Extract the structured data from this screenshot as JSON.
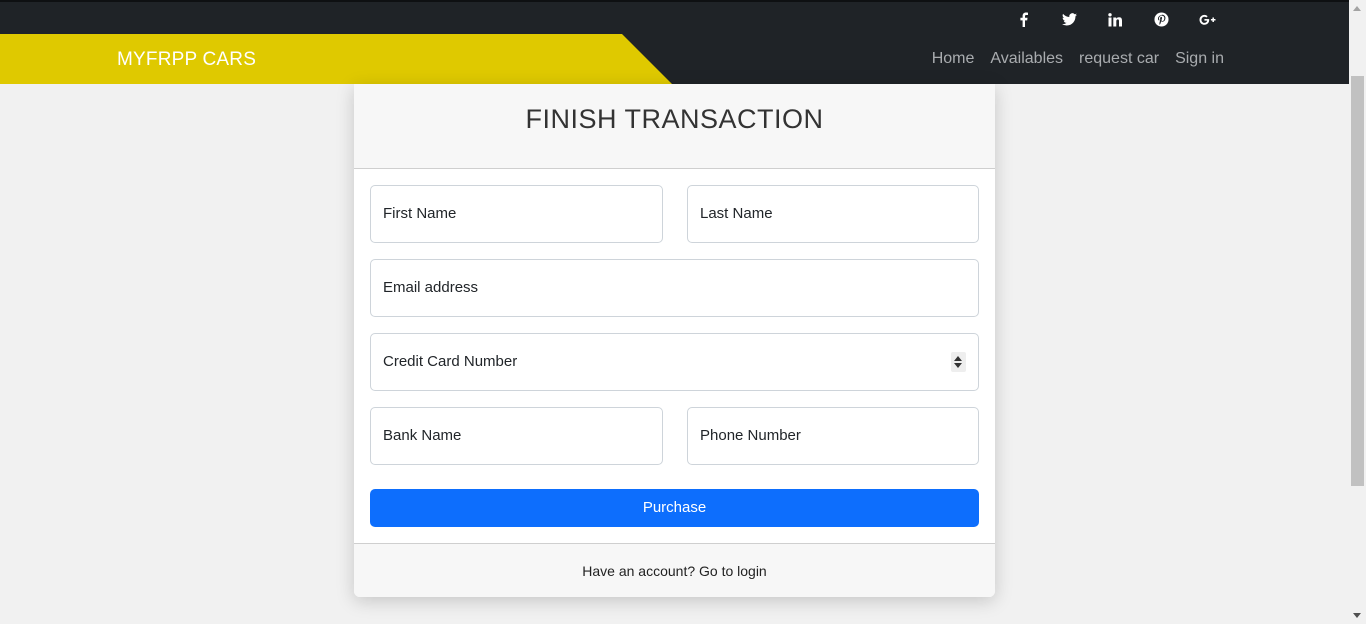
{
  "social": {
    "icons": [
      "facebook-icon",
      "twitter-icon",
      "linkedin-icon",
      "pinterest-icon",
      "google-plus-icon"
    ],
    "labels": [
      "f",
      "",
      "in",
      "",
      "g+"
    ]
  },
  "nav": {
    "brand": "MYFRPP CARS",
    "links": [
      "Home",
      "Availables",
      "request car",
      "Sign in"
    ]
  },
  "card": {
    "title": "FINISH TRANSACTION",
    "fields": {
      "first_name": "First Name",
      "last_name": "Last Name",
      "email": "Email address",
      "credit_card": "Credit Card Number",
      "bank_name": "Bank Name",
      "phone": "Phone Number"
    },
    "button": "Purchase",
    "footer": "Have an account? Go to login"
  },
  "colors": {
    "brand_yellow": "#dfc900",
    "navbar_dark": "#1f2327",
    "button_blue": "#0d6efd"
  }
}
